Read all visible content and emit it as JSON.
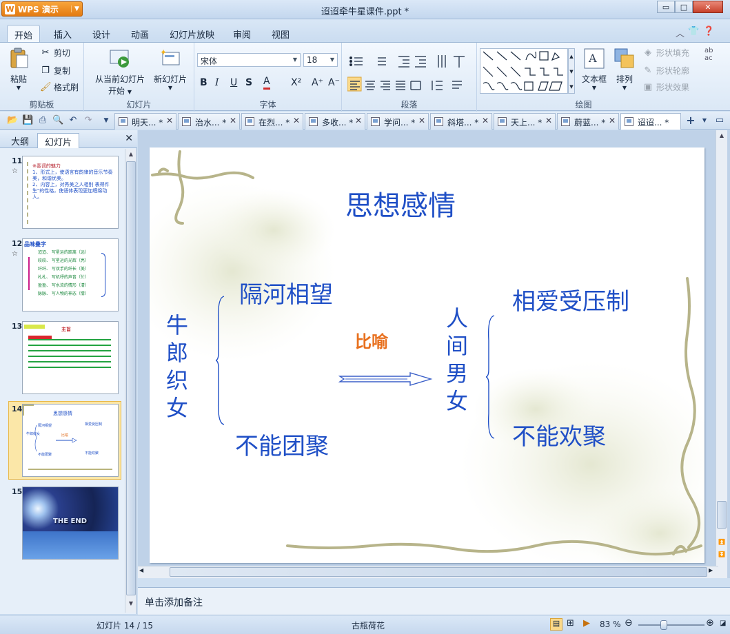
{
  "app": {
    "name": "WPS 演示",
    "doc_title": "迢迢牵牛星课件.ppt *"
  },
  "window_controls": {
    "minimize": "▭",
    "maximize": "□",
    "close": "✕"
  },
  "ribbon_tabs": [
    "开始",
    "插入",
    "设计",
    "动画",
    "幻灯片放映",
    "审阅",
    "视图"
  ],
  "ribbon": {
    "clipboard": {
      "paste": "粘贴",
      "cut": "剪切",
      "copy": "复制",
      "format_painter": "格式刷",
      "label": "剪贴板"
    },
    "slides": {
      "from_current": "从当前幻灯片",
      "start": "开始",
      "new_slide": "新幻灯片",
      "label": "幻灯片"
    },
    "font": {
      "name": "宋体",
      "size": "18",
      "label": "字体",
      "bold": "B",
      "italic": "I",
      "underline": "U",
      "shadow": "S",
      "color": "A",
      "super": "X²",
      "grow": "A⁺",
      "shrink": "A⁻"
    },
    "paragraph": {
      "label": "段落"
    },
    "drawing": {
      "textbox": "文本框",
      "arrange": "排列",
      "shape_fill": "形状填充",
      "shape_outline": "形状轮廓",
      "shape_effect": "形状效果",
      "label": "绘图"
    }
  },
  "doc_tabs": [
    {
      "label": "明天... *"
    },
    {
      "label": "治水... *"
    },
    {
      "label": "在烈... *"
    },
    {
      "label": "多收... *"
    },
    {
      "label": "学问... *"
    },
    {
      "label": "斜塔... *"
    },
    {
      "label": "天上... *"
    },
    {
      "label": "蔚蓝... *"
    },
    {
      "label": "迢迢... *"
    }
  ],
  "left_pane": {
    "tab_outline": "大纲",
    "tab_slides": "幻灯片",
    "thumbs": [
      {
        "num": "11",
        "title": "※奏词的魅力",
        "lines": [
          "1、形式上，使语言有韵律的音乐节奏",
          "美，和谐优美。",
          "2、内容上，对秀美之人相别 表得件",
          "生\"的性格，使语体表现更加缠绵动",
          "人。"
        ]
      },
      {
        "num": "12",
        "title": "品味叠字",
        "rows": [
          "迢迢、 写星运的距离（远）",
          "皎皎、 写星运的光辉（亮）",
          "纤纤、 写双手的纤长（美）",
          "札札、 写机杼的声音（忙）",
          "盈盈、 写水流的情形（清）",
          "脉脉、 写人物的神态（情）"
        ]
      },
      {
        "num": "13",
        "title": "主旨"
      },
      {
        "num": "14",
        "title": "思想感情"
      },
      {
        "num": "15",
        "caption": "THE END"
      }
    ]
  },
  "slide": {
    "title": "思想感情",
    "left_label": "牛郎织女",
    "left_top": "隔河相望",
    "left_bottom": "不能团聚",
    "middle": "比喻",
    "right_label": "人间男女",
    "right_top": "相爱受压制",
    "right_bottom": "不能欢聚"
  },
  "notes_placeholder": "单击添加备注",
  "status": {
    "slide_index": "幻灯片 14 / 15",
    "theme": "古瓶荷花",
    "zoom": "83 %"
  }
}
